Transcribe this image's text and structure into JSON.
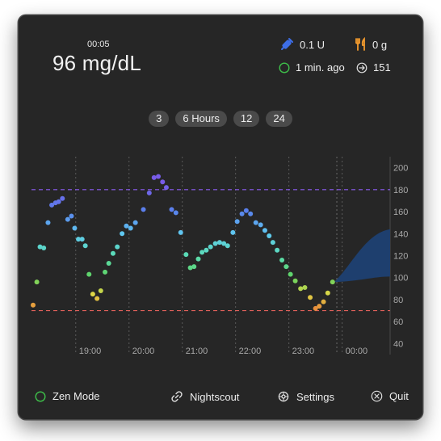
{
  "header": {
    "time": "00:05",
    "glucose": "96 mg/dL",
    "insulin": "0.1 U",
    "carbs": "0 g",
    "last_update": "1 min. ago",
    "trend_value": "151"
  },
  "range_buttons": [
    "3",
    "6 Hours",
    "12",
    "24"
  ],
  "footer": {
    "zen_mode": "Zen Mode",
    "nightscout": "Nightscout",
    "settings": "Settings",
    "quit": "Quit"
  },
  "colors": {
    "background": "#262626",
    "high_line": "#8a5cf0",
    "low_line": "#e0605a",
    "forecast": "#1e3f6e"
  },
  "chart_data": {
    "type": "scatter",
    "x_labels": [
      "19:00",
      "20:00",
      "21:00",
      "22:00",
      "23:00",
      "00:00"
    ],
    "y_ticks": [
      40,
      60,
      80,
      100,
      120,
      140,
      160,
      180,
      200
    ],
    "ylim": [
      30,
      210
    ],
    "high_threshold": 180,
    "low_threshold": 70,
    "x_range_hours": [
      18.17,
      24.9
    ],
    "points": [
      {
        "t": 18.2,
        "v": 75
      },
      {
        "t": 18.27,
        "v": 96
      },
      {
        "t": 18.33,
        "v": 128
      },
      {
        "t": 18.4,
        "v": 127
      },
      {
        "t": 18.48,
        "v": 150
      },
      {
        "t": 18.55,
        "v": 166
      },
      {
        "t": 18.62,
        "v": 168
      },
      {
        "t": 18.68,
        "v": 169
      },
      {
        "t": 18.75,
        "v": 172
      },
      {
        "t": 18.85,
        "v": 153
      },
      {
        "t": 18.92,
        "v": 156
      },
      {
        "t": 18.98,
        "v": 145
      },
      {
        "t": 19.05,
        "v": 135
      },
      {
        "t": 19.12,
        "v": 135
      },
      {
        "t": 19.18,
        "v": 129
      },
      {
        "t": 19.25,
        "v": 103
      },
      {
        "t": 19.32,
        "v": 85
      },
      {
        "t": 19.4,
        "v": 81
      },
      {
        "t": 19.47,
        "v": 88
      },
      {
        "t": 19.55,
        "v": 105
      },
      {
        "t": 19.62,
        "v": 113
      },
      {
        "t": 19.7,
        "v": 122
      },
      {
        "t": 19.78,
        "v": 128
      },
      {
        "t": 19.87,
        "v": 140
      },
      {
        "t": 19.95,
        "v": 147
      },
      {
        "t": 20.03,
        "v": 145
      },
      {
        "t": 20.12,
        "v": 150
      },
      {
        "t": 20.27,
        "v": 162
      },
      {
        "t": 20.38,
        "v": 177
      },
      {
        "t": 20.47,
        "v": 191
      },
      {
        "t": 20.55,
        "v": 192
      },
      {
        "t": 20.63,
        "v": 187
      },
      {
        "t": 20.7,
        "v": 182
      },
      {
        "t": 20.8,
        "v": 162
      },
      {
        "t": 20.88,
        "v": 159
      },
      {
        "t": 20.97,
        "v": 141
      },
      {
        "t": 21.07,
        "v": 121
      },
      {
        "t": 21.15,
        "v": 109
      },
      {
        "t": 21.22,
        "v": 110
      },
      {
        "t": 21.3,
        "v": 117
      },
      {
        "t": 21.37,
        "v": 123
      },
      {
        "t": 21.45,
        "v": 125
      },
      {
        "t": 21.53,
        "v": 128
      },
      {
        "t": 21.62,
        "v": 131
      },
      {
        "t": 21.7,
        "v": 132
      },
      {
        "t": 21.78,
        "v": 131
      },
      {
        "t": 21.85,
        "v": 129
      },
      {
        "t": 21.95,
        "v": 141
      },
      {
        "t": 22.03,
        "v": 151
      },
      {
        "t": 22.12,
        "v": 158
      },
      {
        "t": 22.2,
        "v": 161
      },
      {
        "t": 22.28,
        "v": 158
      },
      {
        "t": 22.38,
        "v": 150
      },
      {
        "t": 22.47,
        "v": 148
      },
      {
        "t": 22.55,
        "v": 143
      },
      {
        "t": 22.63,
        "v": 138
      },
      {
        "t": 22.7,
        "v": 132
      },
      {
        "t": 22.78,
        "v": 125
      },
      {
        "t": 22.87,
        "v": 116
      },
      {
        "t": 22.95,
        "v": 110
      },
      {
        "t": 23.03,
        "v": 103
      },
      {
        "t": 23.12,
        "v": 97
      },
      {
        "t": 23.22,
        "v": 90
      },
      {
        "t": 23.3,
        "v": 91
      },
      {
        "t": 23.4,
        "v": 82
      },
      {
        "t": 23.5,
        "v": 72
      },
      {
        "t": 23.57,
        "v": 74
      },
      {
        "t": 23.65,
        "v": 78
      },
      {
        "t": 23.73,
        "v": 86
      },
      {
        "t": 23.82,
        "v": 96
      }
    ],
    "forecast": {
      "start_t": 23.85,
      "end_t": 24.9,
      "start_v": 96,
      "upper_end": 144,
      "lower_end": 101
    }
  }
}
